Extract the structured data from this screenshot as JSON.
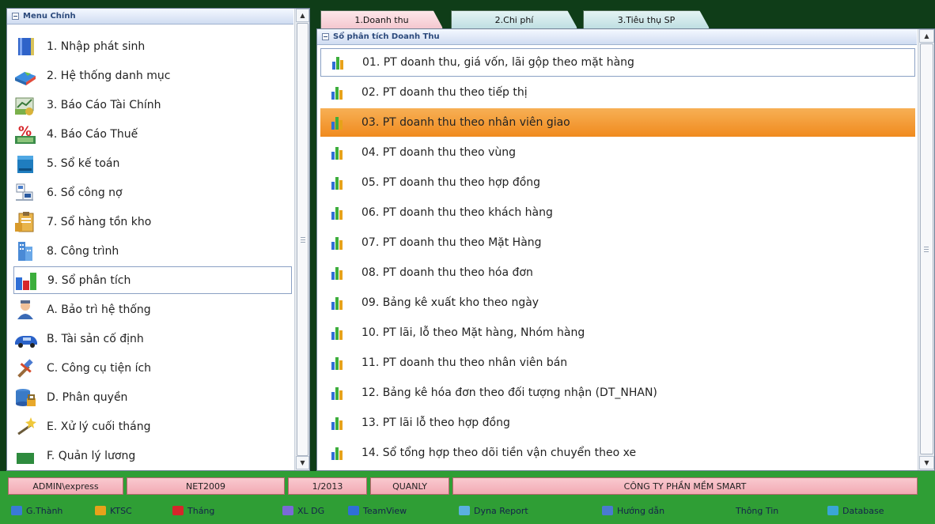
{
  "left_menu": {
    "header": "Menu Chính",
    "items": [
      {
        "label": "1. Nhập phát sinh",
        "icon": "book-icon"
      },
      {
        "label": "2. Hệ thống danh mục",
        "icon": "cube-icon"
      },
      {
        "label": "3. Báo Cáo Tài Chính",
        "icon": "money-chart-icon"
      },
      {
        "label": "4. Báo Cáo Thuế",
        "icon": "percent-icon"
      },
      {
        "label": "5. Sổ kế toán",
        "icon": "ledger-icon"
      },
      {
        "label": "6. Sổ công nợ",
        "icon": "debt-icon"
      },
      {
        "label": "7. Sổ hàng tồn kho",
        "icon": "clipboard-icon"
      },
      {
        "label": "8. Công trình",
        "icon": "building-icon"
      },
      {
        "label": "9. Sổ phân tích",
        "icon": "bar-chart-icon",
        "active": true
      },
      {
        "label": "A. Bảo trì hệ thống",
        "icon": "technician-icon"
      },
      {
        "label": "B. Tài sản cố định",
        "icon": "car-icon"
      },
      {
        "label": "C. Công cụ tiện ích",
        "icon": "tools-icon"
      },
      {
        "label": "D. Phân quyền",
        "icon": "database-lock-icon"
      },
      {
        "label": "E. Xử lý cuối tháng",
        "icon": "wand-icon"
      },
      {
        "label": "F. Quản lý lương",
        "icon": "payroll-icon"
      }
    ]
  },
  "tabs": [
    {
      "label": "1.Doanh thu",
      "active": true
    },
    {
      "label": "2.Chi phí",
      "active": false
    },
    {
      "label": "3.Tiêu thụ SP",
      "active": false
    }
  ],
  "reports": {
    "header": "Sổ phân tích Doanh Thu",
    "items": [
      {
        "label": "01. PT doanh thu, giá vốn, lãi gộp theo mặt hàng",
        "state": "focused"
      },
      {
        "label": "02. PT doanh thu theo tiếp thị",
        "state": ""
      },
      {
        "label": "03. PT doanh thu theo nhân viên giao",
        "state": "selected"
      },
      {
        "label": "04. PT doanh thu theo vùng",
        "state": ""
      },
      {
        "label": "05. PT doanh thu theo hợp đồng",
        "state": ""
      },
      {
        "label": "06. PT doanh thu theo khách hàng",
        "state": ""
      },
      {
        "label": "07. PT doanh thu theo Mặt Hàng",
        "state": ""
      },
      {
        "label": "08. PT doanh thu theo hóa đơn",
        "state": ""
      },
      {
        "label": "09. Bảng kê xuất kho theo ngày",
        "state": ""
      },
      {
        "label": "10. PT lãi, lỗ theo Mặt hàng, Nhóm hàng",
        "state": ""
      },
      {
        "label": "11. PT doanh thu theo nhân viên bán",
        "state": ""
      },
      {
        "label": "12. Bảng kê hóa đơn theo đối tượng nhận (DT_NHAN)",
        "state": ""
      },
      {
        "label": "13. PT lãi lỗ theo hợp đồng",
        "state": ""
      },
      {
        "label": "14. Sổ tổng hợp theo dõi tiền vận chuyển theo xe",
        "state": ""
      }
    ]
  },
  "status": {
    "user": "ADMIN\\express",
    "database": "NET2009",
    "period": "1/2013",
    "role": "QUANLY",
    "company": "CÔNG TY PHẦN MỀM SMART"
  },
  "toolbar": {
    "items": [
      {
        "label": "G.Thành",
        "icon": "gthanh-icon"
      },
      {
        "label": "KTSC",
        "icon": "ktsc-icon"
      },
      {
        "label": "Tháng",
        "icon": "calendar-icon"
      },
      {
        "label": "XL DG",
        "icon": "xldg-icon"
      },
      {
        "label": "TeamView",
        "icon": "teamviewer-icon"
      },
      {
        "label": "Dyna Report",
        "icon": "dyna-report-icon"
      },
      {
        "label": "Hướng dẫn",
        "icon": "help-icon"
      },
      {
        "label": "Thông Tin",
        "icon": ""
      },
      {
        "label": "Database",
        "icon": "database-icon"
      }
    ]
  },
  "colors": {
    "selected_row": "#f08a1e",
    "status_bg": "#2f9e35",
    "status_cell": "#f2aab4",
    "header_text": "#2c4a7c"
  }
}
